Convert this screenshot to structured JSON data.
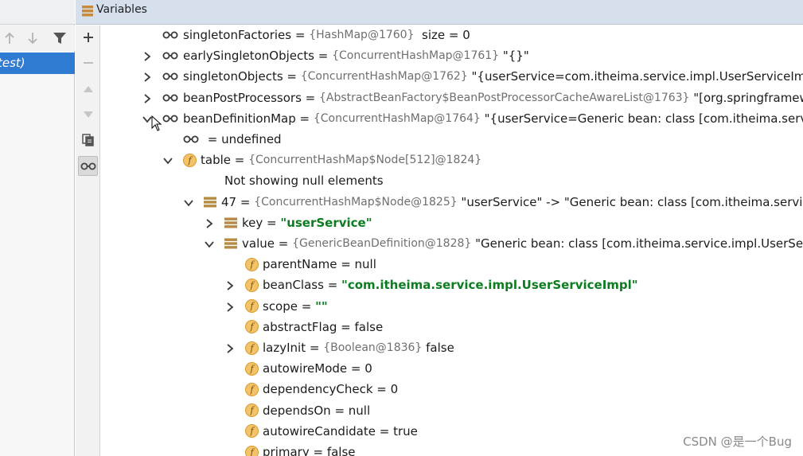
{
  "frames": {
    "selected_frame_text": "test)"
  },
  "variables_panel": {
    "title": "Variables"
  },
  "tree": [
    {
      "indent": 0,
      "expander": "none",
      "icon": "glasses",
      "name": "singletonFactories",
      "type": "{HashMap@1760}",
      "value": " size = 0",
      "value_style": "plain"
    },
    {
      "indent": 0,
      "expander": "collapsed",
      "icon": "glasses",
      "name": "earlySingletonObjects",
      "type": "{ConcurrentHashMap@1761}",
      "value": "\"{}\"",
      "value_style": "plain"
    },
    {
      "indent": 0,
      "expander": "collapsed",
      "icon": "glasses",
      "name": "singletonObjects",
      "type": "{ConcurrentHashMap@1762}",
      "value": "\"{userService=com.itheima.service.impl.UserServiceImpl@",
      "value_style": "plain"
    },
    {
      "indent": 0,
      "expander": "collapsed",
      "icon": "glasses",
      "name": "beanPostProcessors",
      "type": "{AbstractBeanFactory$BeanPostProcessorCacheAwareList@1763}",
      "value": "\"[org.springframew",
      "value_style": "plain"
    },
    {
      "indent": 0,
      "expander": "expanded",
      "icon": "glasses",
      "name": "beanDefinitionMap",
      "type": "{ConcurrentHashMap@1764}",
      "value": "\"{userService=Generic bean: class [com.itheima.service.i",
      "value_style": "plain"
    },
    {
      "indent": 1,
      "expander": "none",
      "icon": "glasses",
      "name": "",
      "type": "",
      "value": "undefined",
      "value_style": "plain"
    },
    {
      "indent": 1,
      "expander": "expanded",
      "icon": "field",
      "name": "table",
      "type": "{ConcurrentHashMap$Node[512]@1824}",
      "value": "",
      "value_style": "plain"
    },
    {
      "indent": 2,
      "expander": "none",
      "icon": "none",
      "name": "Not showing null elements",
      "type": "",
      "value": "",
      "value_style": "note"
    },
    {
      "indent": 2,
      "expander": "expanded",
      "icon": "entry",
      "name": "47",
      "type": "{ConcurrentHashMap$Node@1825}",
      "value": "\"userService\" -> \"Generic bean: class [com.itheima.service.i",
      "value_style": "plain"
    },
    {
      "indent": 3,
      "expander": "collapsed",
      "icon": "entry",
      "name": "key",
      "type": "",
      "value": "\"userService\"",
      "value_style": "string"
    },
    {
      "indent": 3,
      "expander": "expanded",
      "icon": "entry",
      "name": "value",
      "type": "{GenericBeanDefinition@1828}",
      "value": "\"Generic bean: class [com.itheima.service.impl.UserService",
      "value_style": "plain"
    },
    {
      "indent": 4,
      "expander": "none",
      "icon": "field",
      "name": "parentName",
      "type": "",
      "value": "null",
      "value_style": "plain"
    },
    {
      "indent": 4,
      "expander": "collapsed",
      "icon": "field",
      "name": "beanClass",
      "type": "",
      "value": "\"com.itheima.service.impl.UserServiceImpl\"",
      "value_style": "string"
    },
    {
      "indent": 4,
      "expander": "collapsed",
      "icon": "field",
      "name": "scope",
      "type": "",
      "value": "\"\"",
      "value_style": "string"
    },
    {
      "indent": 4,
      "expander": "none",
      "icon": "field",
      "name": "abstractFlag",
      "type": "",
      "value": "false",
      "value_style": "plain"
    },
    {
      "indent": 4,
      "expander": "collapsed",
      "icon": "field",
      "name": "lazyInit",
      "type": "{Boolean@1836}",
      "value": "false",
      "value_style": "plain"
    },
    {
      "indent": 4,
      "expander": "none",
      "icon": "field",
      "name": "autowireMode",
      "type": "",
      "value": "0",
      "value_style": "plain"
    },
    {
      "indent": 4,
      "expander": "none",
      "icon": "field",
      "name": "dependencyCheck",
      "type": "",
      "value": "0",
      "value_style": "plain"
    },
    {
      "indent": 4,
      "expander": "none",
      "icon": "field",
      "name": "dependsOn",
      "type": "",
      "value": "null",
      "value_style": "plain"
    },
    {
      "indent": 4,
      "expander": "none",
      "icon": "field",
      "name": "autowireCandidate",
      "type": "",
      "value": "true",
      "value_style": "plain"
    },
    {
      "indent": 4,
      "expander": "none",
      "icon": "field",
      "name": "primary",
      "type": "",
      "value": "false",
      "value_style": "plain"
    }
  ],
  "watermark": "CSDN @是一个Bug",
  "icons": {
    "up": "arrow-up-icon",
    "down": "arrow-down-icon",
    "filter": "filter-icon",
    "add": "plus-icon",
    "remove": "minus-icon",
    "move_up": "triangle-up-icon",
    "move_down": "triangle-down-icon",
    "copy": "copy-icon",
    "watches": "glasses-icon"
  },
  "colors": {
    "selection": "#2f7bd1",
    "string_value": "#0b7d20",
    "type_text": "#6f6f6f",
    "field_icon": "#f3c36a"
  }
}
